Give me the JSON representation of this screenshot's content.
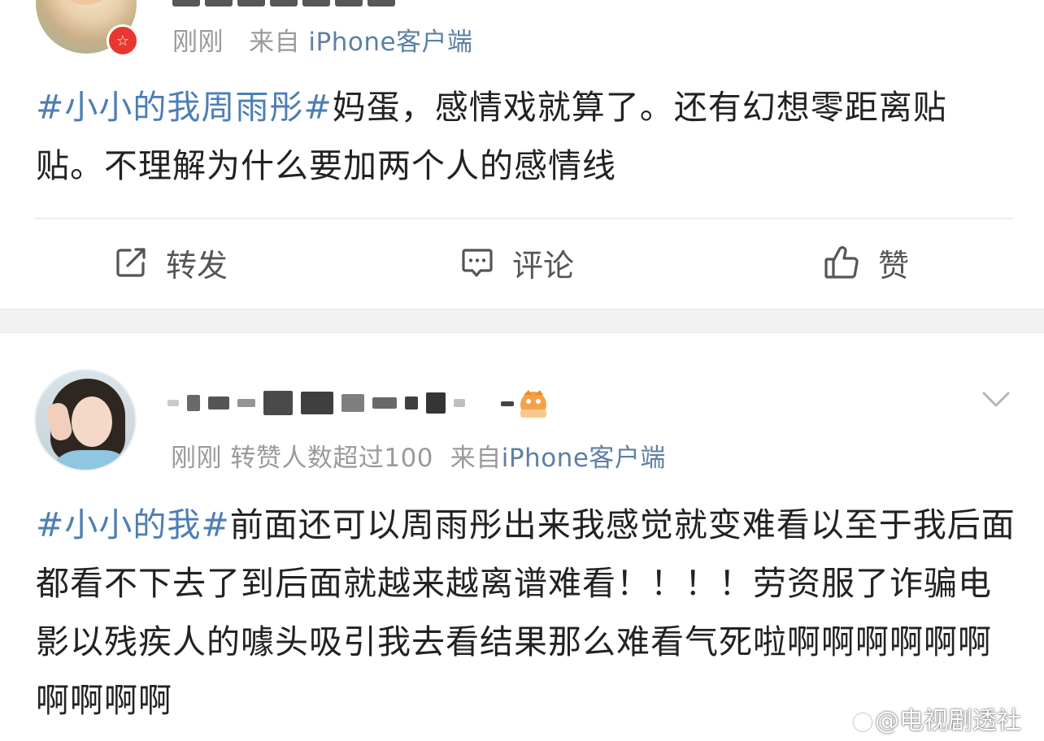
{
  "post1": {
    "time": "刚刚",
    "source_prefix": "来自",
    "source": "iPhone客户端",
    "hashtag": "#小小的我周雨彤#",
    "text": "妈蛋，感情戏就算了。还有幻想零距离贴贴。不理解为什么要加两个人的感情线",
    "actions": {
      "repost": "转发",
      "comment": "评论",
      "like": "赞"
    }
  },
  "post2": {
    "time": "刚刚",
    "reposts_note": "转赞人数超过100",
    "source_prefix": "来自",
    "source": "iPhone客户端",
    "hashtag": "#小小的我#",
    "text": "前面还可以周雨彤出来我感觉就变难看以至于我后面都看不下去了到后面就越来越离谱难看！！！！劳资服了诈骗电影以残疾人的噱头吸引我去看结果那么难看气死啦啊啊啊啊啊啊啊啊啊啊"
  },
  "watermark": "@电视剧透社",
  "colors": {
    "link": "#4d7eb5",
    "meta": "#9a9a9a",
    "verified": "#e8372f"
  }
}
